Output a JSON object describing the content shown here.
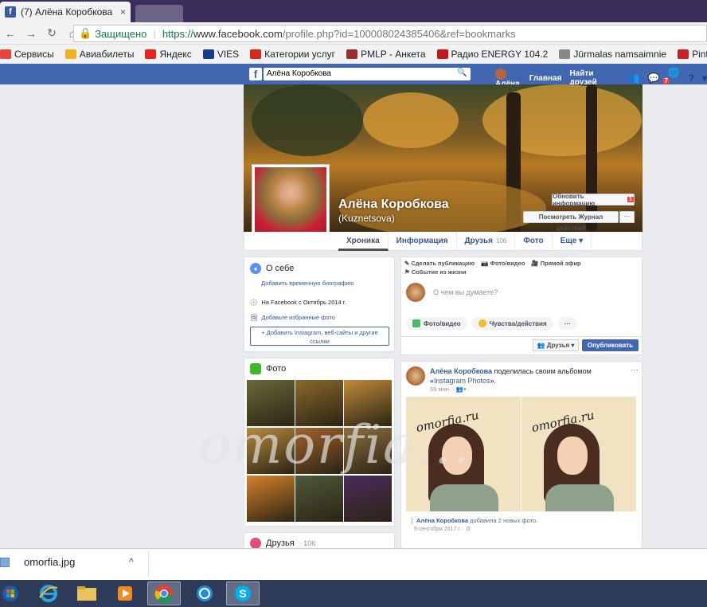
{
  "browser": {
    "tab_title": "(7) Алёна Коробкова",
    "tab_close": "×",
    "secure_label": "Защищено",
    "url_scheme": "https://",
    "url_host": "www.facebook.com",
    "url_rest": "/profile.php?id=100008024385406&ref=bookmarks"
  },
  "bookmarks": [
    {
      "label": "Сервисы",
      "color": "#e8453c"
    },
    {
      "label": "Авиабилеты",
      "color": "#f2b01e"
    },
    {
      "label": "Яндекс",
      "color": "#e52620"
    },
    {
      "label": "VIES",
      "color": "#1a3a8f"
    },
    {
      "label": "Категории услуг",
      "color": "#d52b1e"
    },
    {
      "label": "PMLP - Анкета",
      "color": "#9e2b2f"
    },
    {
      "label": "Радио ENERGY 104.2",
      "color": "#c4161c"
    },
    {
      "label": "Jūrmalas namsaimnie",
      "color": "#888888"
    },
    {
      "label": "Pinterest • Всемирны",
      "color": "#cb2027"
    }
  ],
  "fb": {
    "logo": "f",
    "search_value": "Алёна Коробкова",
    "nav_user": "Алёна",
    "nav_home": "Главная",
    "nav_find": "Найти друзей",
    "notif_count": "7",
    "help": "?"
  },
  "profile": {
    "name": "Алёна Коробкова",
    "subname": "(Kuznetsova)",
    "update_btn": "Обновить информацию",
    "update_count": "1",
    "activity_log_btn": "Посмотреть Журнал действий",
    "more_btn": "···"
  },
  "tabs": [
    {
      "label": "Хроника",
      "count": ""
    },
    {
      "label": "Информация",
      "count": ""
    },
    {
      "label": "Друзья",
      "count": "106"
    },
    {
      "label": "Фото",
      "count": ""
    },
    {
      "label": "Еще ▾",
      "count": ""
    }
  ],
  "intro": {
    "title": "О себе",
    "add_bio": "Добавить временную биографию",
    "since": "На Facebook с Октябрь 2014 г.",
    "add_fav_photos": "Добавьте избранные фото",
    "add_links": "+ Добавить Instagram, веб-сайты и другие ссылки"
  },
  "photos": {
    "title": "Фото",
    "tiles": [
      "#6a6a3a",
      "#8a6a2a",
      "#c28a3a",
      "#b9893d",
      "#a2622a",
      "#8d7040",
      "#d6822a",
      "#4f5a3a",
      "#4c2b5c"
    ]
  },
  "friends": {
    "title": "Друзья",
    "count": "· 106"
  },
  "composer": {
    "create_post": "Сделать публикацию",
    "photo_video": "Фото/видео",
    "live": "Прямой эфир",
    "life_event": "Событие из жизни",
    "placeholder": "О чем вы думаете?",
    "btn_photo": "Фото/видео",
    "btn_feelings": "Чувства/действия",
    "btn_more": "···",
    "privacy": "Друзья ▾",
    "publish": "Опубликовать"
  },
  "post": {
    "author": "Алёна Коробкова",
    "action": " поделилась своим альбомом «",
    "album": "Instagram Photos",
    "action_end": "».",
    "time": "59 мин. · ",
    "dots": "···",
    "watermark": "omorfia.ru",
    "share_author": "Алёна Коробкова",
    "share_text": " добавила 2 новых фото.",
    "share_date": "9 сентября 2017 г. · "
  },
  "page_watermark": "omorfia...",
  "download": {
    "filename": "omorfia.jpg",
    "chevron": "^"
  },
  "colors": {
    "fb_blue": "#4267b2",
    "link": "#365899",
    "taskbar": "#2e3c5a"
  }
}
